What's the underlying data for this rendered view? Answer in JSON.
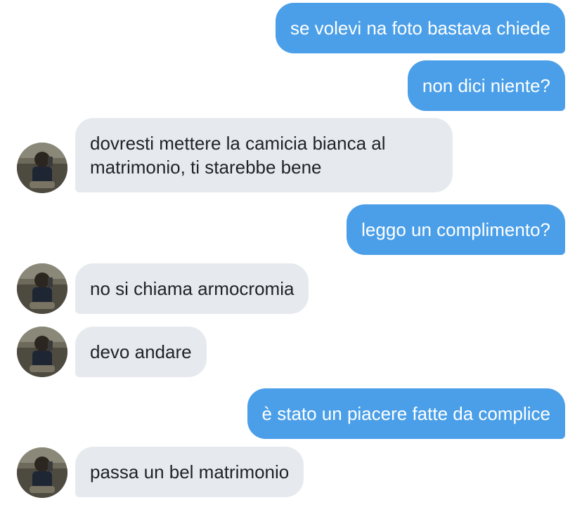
{
  "conversation": {
    "messages": [
      {
        "direction": "sent",
        "text": "se volevi na foto bastava chiede"
      },
      {
        "direction": "sent",
        "text": "non dici niente?"
      },
      {
        "direction": "received",
        "text": "dovresti mettere la camicia bianca al matrimonio, ti starebbe bene"
      },
      {
        "direction": "sent",
        "text": "leggo un complimento?"
      },
      {
        "direction": "received",
        "text": "no si chiama armocromia"
      },
      {
        "direction": "received",
        "text": "devo andare"
      },
      {
        "direction": "sent",
        "text": "è stato un piacere fatte da complice"
      },
      {
        "direction": "received",
        "text": "passa un bel matrimonio"
      }
    ]
  },
  "colors": {
    "sent_bubble": "#4a9fe8",
    "received_bubble": "#e6eaee",
    "background": "#ffffff"
  },
  "icons": {
    "avatar": "user-avatar-photo"
  }
}
